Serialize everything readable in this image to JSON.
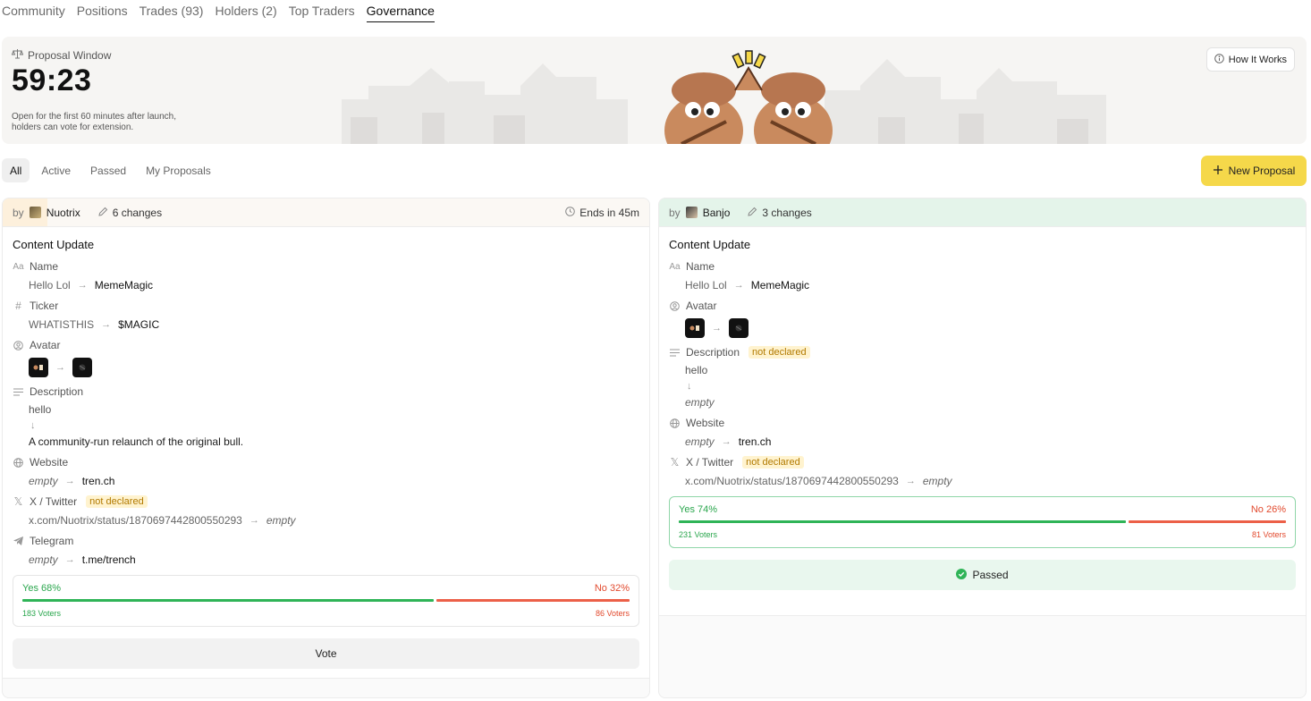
{
  "top_tabs": [
    "Community",
    "Positions",
    "Trades (93)",
    "Holders (2)",
    "Top Traders",
    "Governance"
  ],
  "banner": {
    "label": "Proposal Window",
    "timer": "59:23",
    "description": "Open for the first 60 minutes after launch, holders can vote for extension.",
    "how_it_works": "How It Works"
  },
  "filters": [
    "All",
    "Active",
    "Passed",
    "My Proposals"
  ],
  "new_proposal": "New Proposal",
  "colors": {
    "accent": "#f5d84a",
    "yes": "#2fb457",
    "no": "#ec6048",
    "badge": "#fff3cf"
  },
  "proposals": [
    {
      "by": "by",
      "author": "Nuotrix",
      "changes": "6 changes",
      "ends": "Ends in 45m",
      "title": "Content Update",
      "name_label": "Name",
      "name_old": "Hello Lol",
      "name_new": "MemeMagic",
      "ticker_label": "Ticker",
      "ticker_old": "WHATISTHIS",
      "ticker_new": "$MAGIC",
      "avatar_label": "Avatar",
      "desc_label": "Description",
      "desc_old": "hello",
      "desc_new": "A community-run relaunch of the original bull.",
      "website_label": "Website",
      "website_old": "empty",
      "website_new": "tren.ch",
      "twitter_label": "X / Twitter",
      "twitter_badge": "not declared",
      "twitter_old": "x.com/Nuotrix/status/1870697442800550293",
      "twitter_new": "empty",
      "telegram_label": "Telegram",
      "telegram_old": "empty",
      "telegram_new": "t.me/trench",
      "yes_label": "Yes 68%",
      "no_label": "No 32%",
      "yes_fraction": 0.68,
      "yes_voters": "183 Voters",
      "no_voters": "86 Voters",
      "action": "Vote"
    },
    {
      "by": "by",
      "author": "Banjo",
      "changes": "3 changes",
      "title": "Content Update",
      "name_label": "Name",
      "name_old": "Hello Lol",
      "name_new": "MemeMagic",
      "avatar_label": "Avatar",
      "desc_label": "Description",
      "desc_badge": "not declared",
      "desc_old": "hello",
      "desc_new": "empty",
      "website_label": "Website",
      "website_old": "empty",
      "website_new": "tren.ch",
      "twitter_label": "X / Twitter",
      "twitter_badge": "not declared",
      "twitter_old": "x.com/Nuotrix/status/1870697442800550293",
      "twitter_new": "empty",
      "yes_label": "Yes 74%",
      "no_label": "No 26%",
      "yes_fraction": 0.74,
      "yes_voters": "231 Voters",
      "no_voters": "81 Voters",
      "status": "Passed"
    }
  ]
}
